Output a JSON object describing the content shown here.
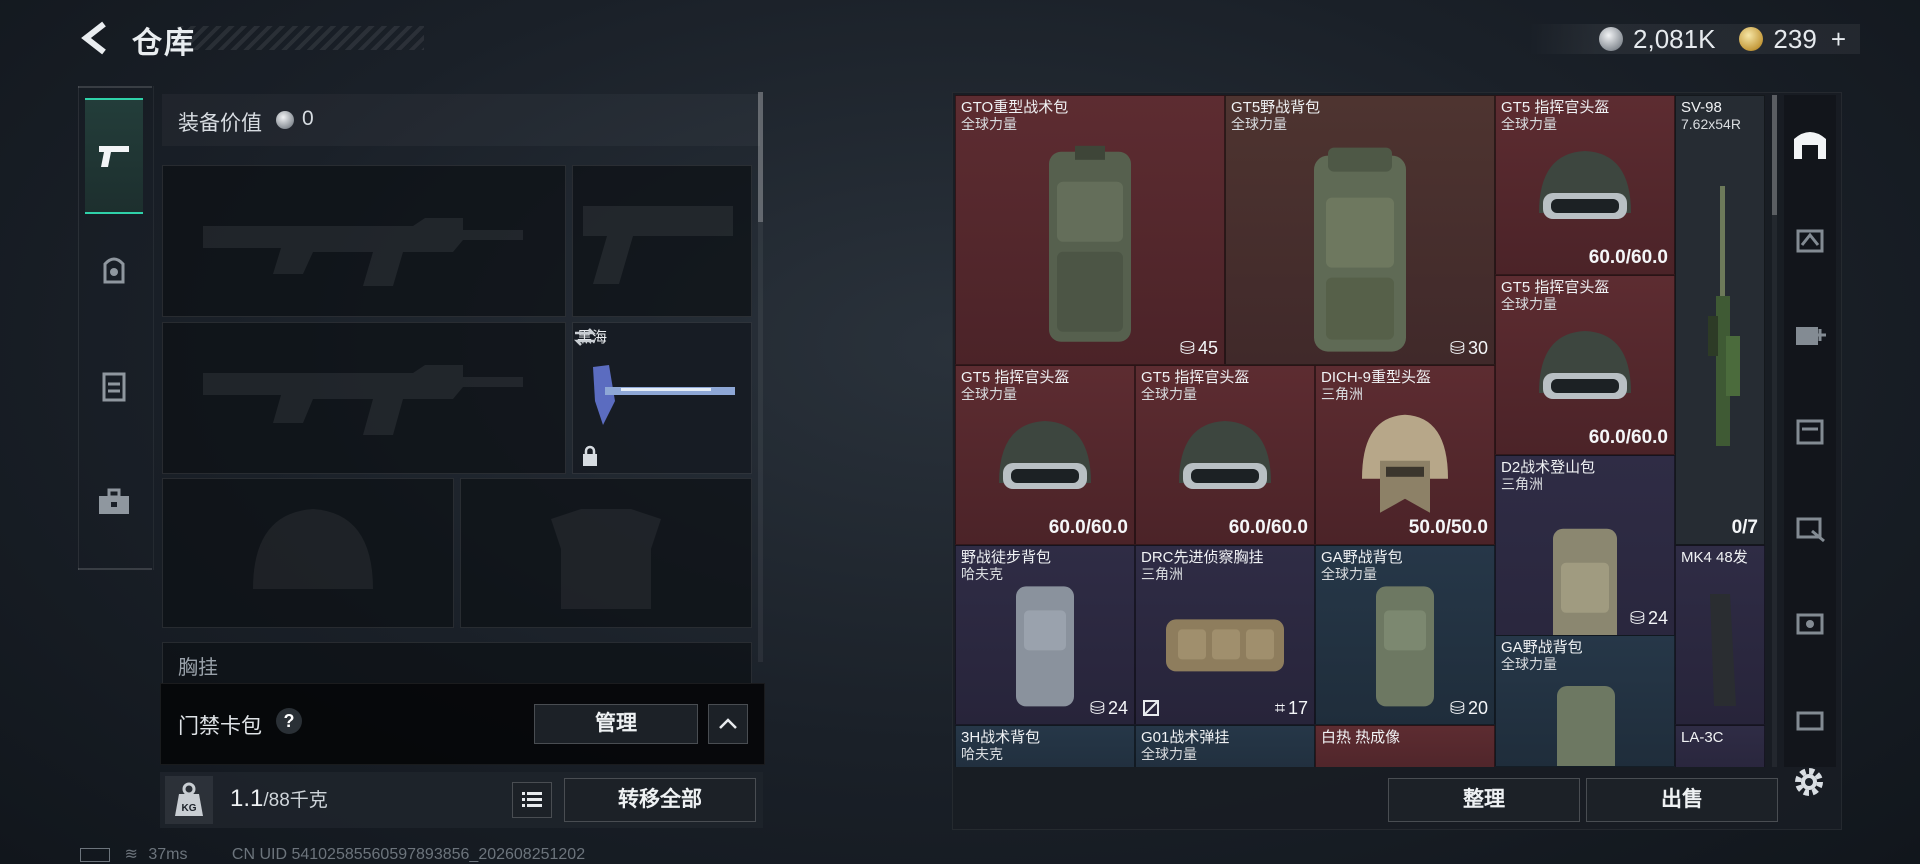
{
  "header": {
    "title": "仓库",
    "currencies": [
      {
        "icon": "silver-coin-icon",
        "value": "2,081K"
      },
      {
        "icon": "gold-coin-icon",
        "value": "239"
      }
    ]
  },
  "equipment": {
    "value_label": "装备价值",
    "value": "0",
    "melee_name": "黑海",
    "chest_label": "胸挂"
  },
  "keycard": {
    "label": "门禁卡包",
    "help": "?",
    "manage": "管理"
  },
  "weight": {
    "current": "1.1",
    "capacity": "/88千克",
    "transfer_all": "转移全部"
  },
  "status": {
    "ping": "37ms",
    "uid": "CN UID 54102585560597893856_202608251202"
  },
  "stash": {
    "items": [
      {
        "name": "GTO重型战术包",
        "sub": "全球力量",
        "count": "45"
      },
      {
        "name": "GT5野战背包",
        "sub": "全球力量",
        "count": "30"
      },
      {
        "name": "GT5 指挥官头盔",
        "sub": "全球力量",
        "dura": "60.0/60.0"
      },
      {
        "name": "SV-98",
        "sub": "7.62x54R",
        "dura": "0/7"
      },
      {
        "name": "GT5 指挥官头盔",
        "sub": "全球力量",
        "dura": "60.0/60.0"
      },
      {
        "name": "GT5 指挥官头盔",
        "sub": "全球力量",
        "dura": "60.0/60.0"
      },
      {
        "name": "GT5 指挥官头盔",
        "sub": "全球力量",
        "dura": "60.0/60.0"
      },
      {
        "name": "DICH-9重型头盔",
        "sub": "三角洲",
        "dura": "50.0/50.0"
      },
      {
        "name": "D2战术登山包",
        "sub": "三角洲",
        "count": "24"
      },
      {
        "name": "野战徒步背包",
        "sub": "哈夫克",
        "count": "24"
      },
      {
        "name": "DRC先进侦察胸挂",
        "sub": "三角洲",
        "count": "17"
      },
      {
        "name": "GA野战背包",
        "sub": "全球力量",
        "count": "20"
      },
      {
        "name": "MK4 48发",
        "sub": ""
      },
      {
        "name": "GA野战背包",
        "sub": "全球力量"
      },
      {
        "name": "3H战术背包",
        "sub": "哈夫克"
      },
      {
        "name": "G01战术弹挂",
        "sub": "全球力量"
      },
      {
        "name": "白热 热成像",
        "sub": ""
      },
      {
        "name": "LA-3C",
        "sub": ""
      }
    ],
    "sort": "整理",
    "sell": "出售"
  }
}
